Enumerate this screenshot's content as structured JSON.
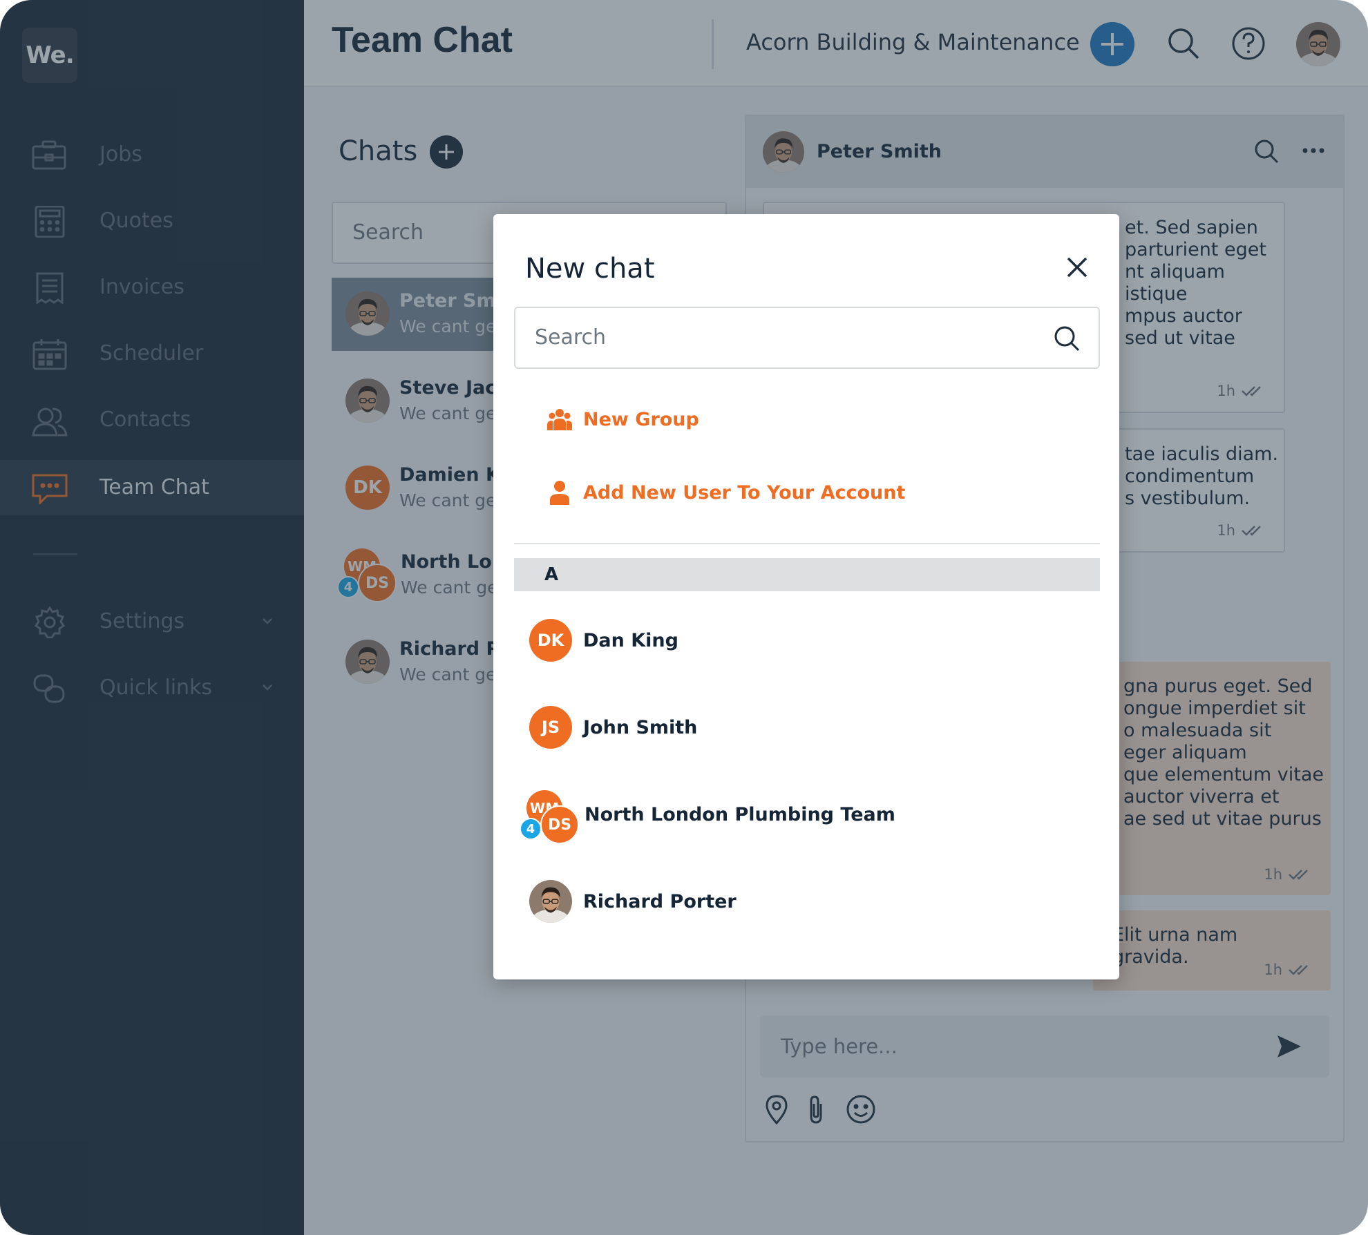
{
  "app": {
    "logo": "We.",
    "page_title": "Team Chat",
    "company": "Acorn Building & Maintenance"
  },
  "sidebar": {
    "items": [
      {
        "label": "Jobs",
        "icon": "briefcase-icon"
      },
      {
        "label": "Quotes",
        "icon": "calculator-icon"
      },
      {
        "label": "Invoices",
        "icon": "receipt-icon"
      },
      {
        "label": "Scheduler",
        "icon": "calendar-icon"
      },
      {
        "label": "Contacts",
        "icon": "contacts-icon"
      },
      {
        "label": "Team Chat",
        "icon": "chat-icon",
        "active": true
      }
    ],
    "bottom_items": [
      {
        "label": "Settings",
        "icon": "gear-icon"
      },
      {
        "label": "Quick links",
        "icon": "link-icon"
      }
    ]
  },
  "chats": {
    "title": "Chats",
    "search_placeholder": "Search",
    "items": [
      {
        "name": "Peter Smit",
        "preview": "We cant get",
        "avatar": "photo",
        "selected": true
      },
      {
        "name": "Steve Jack",
        "preview": "We cant get",
        "avatar": "photo"
      },
      {
        "name": "Damien Kn",
        "preview": "We cant get",
        "avatar": "DK"
      },
      {
        "name": "North Lonc",
        "preview": "We cant get",
        "avatar": "group",
        "group_initials": [
          "WM",
          "DS"
        ],
        "group_count": "4"
      },
      {
        "name": "Richard Po",
        "preview": "We cant get",
        "avatar": "photo"
      }
    ]
  },
  "conversation": {
    "contact": "Peter Smith",
    "messages": [
      {
        "direction": "in",
        "text": "et. Sed sapien\n parturient eget\nnt aliquam\nistique\nmpus auctor\nsed ut vitae",
        "time": "1h"
      },
      {
        "direction": "in",
        "text": "tae iaculis diam.\ncondimentum\ns vestibulum.",
        "time": "1h"
      },
      {
        "direction": "out",
        "text": "gna purus eget. Sed\nongue imperdiet sit\no malesuada sit\neger aliquam\nque elementum vitae\n auctor viverra et\nae sed ut vitae purus",
        "time": "1h"
      },
      {
        "direction": "out",
        "text": "Elit urna nam gravida.",
        "time": "1h"
      }
    ],
    "composer_placeholder": "Type here..."
  },
  "modal": {
    "title": "New chat",
    "search_placeholder": "Search",
    "actions": [
      {
        "label": "New Group",
        "icon": "group-icon"
      },
      {
        "label": "Add New User To Your Account",
        "icon": "add-user-icon"
      }
    ],
    "section_letter": "A",
    "contacts": [
      {
        "name": "Dan King",
        "avatar": "DK"
      },
      {
        "name": "John Smith",
        "avatar": "JS"
      },
      {
        "name": "North London Plumbing Team",
        "avatar": "group",
        "group_initials": [
          "WM",
          "DS"
        ],
        "group_count": "4"
      },
      {
        "name": "Richard Porter",
        "avatar": "photo"
      }
    ]
  },
  "colors": {
    "sidebar": "#1b2a37",
    "accent_orange": "#ef6d22",
    "accent_blue": "#1f78c1",
    "badge_blue": "#1aa5e6"
  }
}
